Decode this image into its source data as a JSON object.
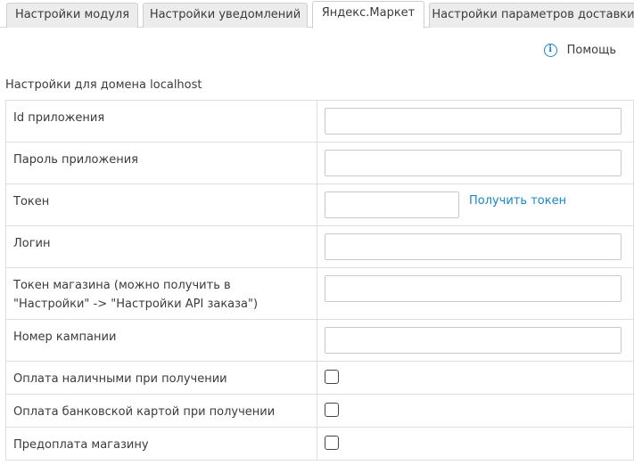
{
  "tabs": [
    {
      "label": "Настройки модуля",
      "active": false
    },
    {
      "label": "Настройки уведомлений",
      "active": false
    },
    {
      "label": "Яндекс.Маркет",
      "active": true
    },
    {
      "label": "Настройки параметров доставки",
      "active": false
    }
  ],
  "help": {
    "label": "Помощь",
    "icon": "info-icon"
  },
  "domain_title": "Настройки для домена localhost",
  "fields": {
    "app_id": {
      "label": "Id приложения",
      "value": ""
    },
    "app_password": {
      "label": "Пароль приложения",
      "value": ""
    },
    "token": {
      "label": "Токен",
      "value": "",
      "link": "Получить токен"
    },
    "login": {
      "label": "Логин",
      "value": ""
    },
    "shop_token": {
      "label": "Токен магазина (можно получить в \"Настройки\" -> \"Настройки API заказа\")",
      "value": ""
    },
    "campaign_number": {
      "label": "Номер кампании",
      "value": ""
    },
    "cash_on_delivery": {
      "label": "Оплата наличными при получении",
      "checked": false
    },
    "card_on_delivery": {
      "label": "Оплата банковской картой при получении",
      "checked": false
    },
    "shop_prepayment": {
      "label": "Предоплата магазину",
      "checked": false
    }
  },
  "colors": {
    "accent": "#1a86c8",
    "border": "#dedede",
    "tab_bg": "#ececec"
  }
}
